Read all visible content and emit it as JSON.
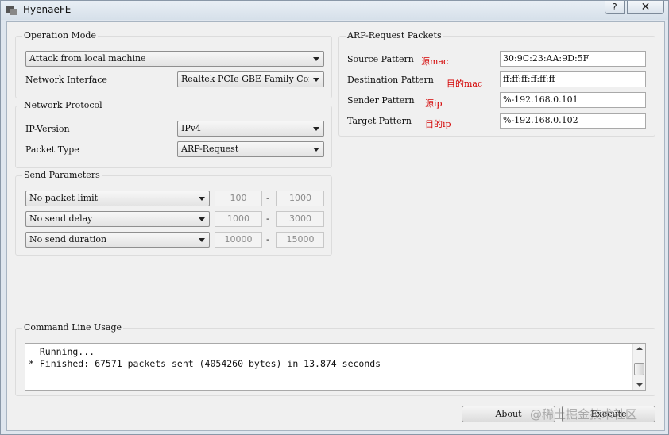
{
  "window": {
    "title": "HyenaeFE",
    "help_label": "?",
    "close_label": "✕"
  },
  "operation_mode": {
    "title": "Operation Mode",
    "mode": "Attack from local machine",
    "interface_label": "Network Interface",
    "interface_value": "Realtek PCIe GBE Family Con"
  },
  "network_protocol": {
    "title": "Network Protocol",
    "ip_version_label": "IP-Version",
    "ip_version_value": "IPv4",
    "packet_type_label": "Packet Type",
    "packet_type_value": "ARP-Request"
  },
  "send_parameters": {
    "title": "Send Parameters",
    "separator": "-",
    "rows": [
      {
        "mode": "No packet limit",
        "min": "100",
        "max": "1000"
      },
      {
        "mode": "No send delay",
        "min": "1000",
        "max": "3000"
      },
      {
        "mode": "No send duration",
        "min": "10000",
        "max": "15000"
      }
    ]
  },
  "arp_request_packets": {
    "title": "ARP-Request Packets",
    "rows": [
      {
        "label": "Source Pattern",
        "note": "源mac",
        "value": "30:9C:23:AA:9D:5F"
      },
      {
        "label": "Destination Pattern",
        "note": "目的mac",
        "value": "ff:ff:ff:ff:ff:ff"
      },
      {
        "label": "Sender Pattern",
        "note": "源ip",
        "value": "%-192.168.0.101"
      },
      {
        "label": "Target Pattern",
        "note": "目的ip",
        "value": "%-192.168.0.102"
      }
    ]
  },
  "command_line": {
    "title": "Command Line Usage",
    "lines": [
      "  Running...",
      "* Finished: 67571 packets sent (4054260 bytes) in 13.874 seconds"
    ]
  },
  "buttons": {
    "about": "About",
    "execute": "Execute"
  },
  "watermark": "@稀土掘金技术社区",
  "colors": {
    "note_red": "#d40000",
    "window_chrome": "#dfe6ee",
    "client_bg": "#f0f0f0"
  }
}
